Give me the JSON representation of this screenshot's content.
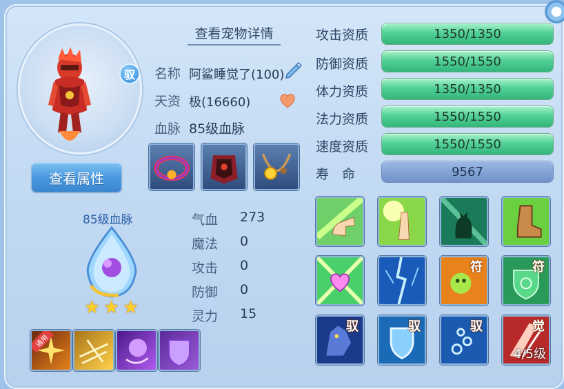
{
  "pet": {
    "name_label": "名称",
    "name_value": "阿鲨睡觉了(100)",
    "aptitude_label": "天资",
    "aptitude_value": "极(16660)",
    "bloodline_label": "血脉",
    "bloodline_value": "85级血脉",
    "yu_badge": "驭"
  },
  "header": {
    "view_detail_link": "查看宠物详情"
  },
  "buttons": {
    "view_attr": "查看属性"
  },
  "bloodline": {
    "title": "85级血脉",
    "stars": 3
  },
  "stats": [
    {
      "label": "气血",
      "value": "273"
    },
    {
      "label": "魔法",
      "value": "0"
    },
    {
      "label": "攻击",
      "value": "0"
    },
    {
      "label": "防御",
      "value": "0"
    },
    {
      "label": "灵力",
      "value": "15"
    }
  ],
  "qualities": [
    {
      "label": "攻击资质",
      "value": "1350/1350"
    },
    {
      "label": "防御资质",
      "value": "1550/1550"
    },
    {
      "label": "体力资质",
      "value": "1350/1350"
    },
    {
      "label": "法力资质",
      "value": "1550/1550"
    },
    {
      "label": "速度资质",
      "value": "1550/1550"
    }
  ],
  "life": {
    "label": "寿　命",
    "value": "9567"
  },
  "bloodline_skills": {
    "ribbon": "通用"
  },
  "skill_tags": {
    "fu": "符",
    "yu": "驭",
    "jue": "觉",
    "level": "4/5级"
  },
  "colors": {
    "bar_green": "#52d196",
    "life_bar": "#6f92c9",
    "panel_bg": "#c3daf3"
  },
  "icons": [
    "edit-icon",
    "heart-icon",
    "pet-portrait",
    "bloodline-drop-icon",
    "star-icon"
  ]
}
